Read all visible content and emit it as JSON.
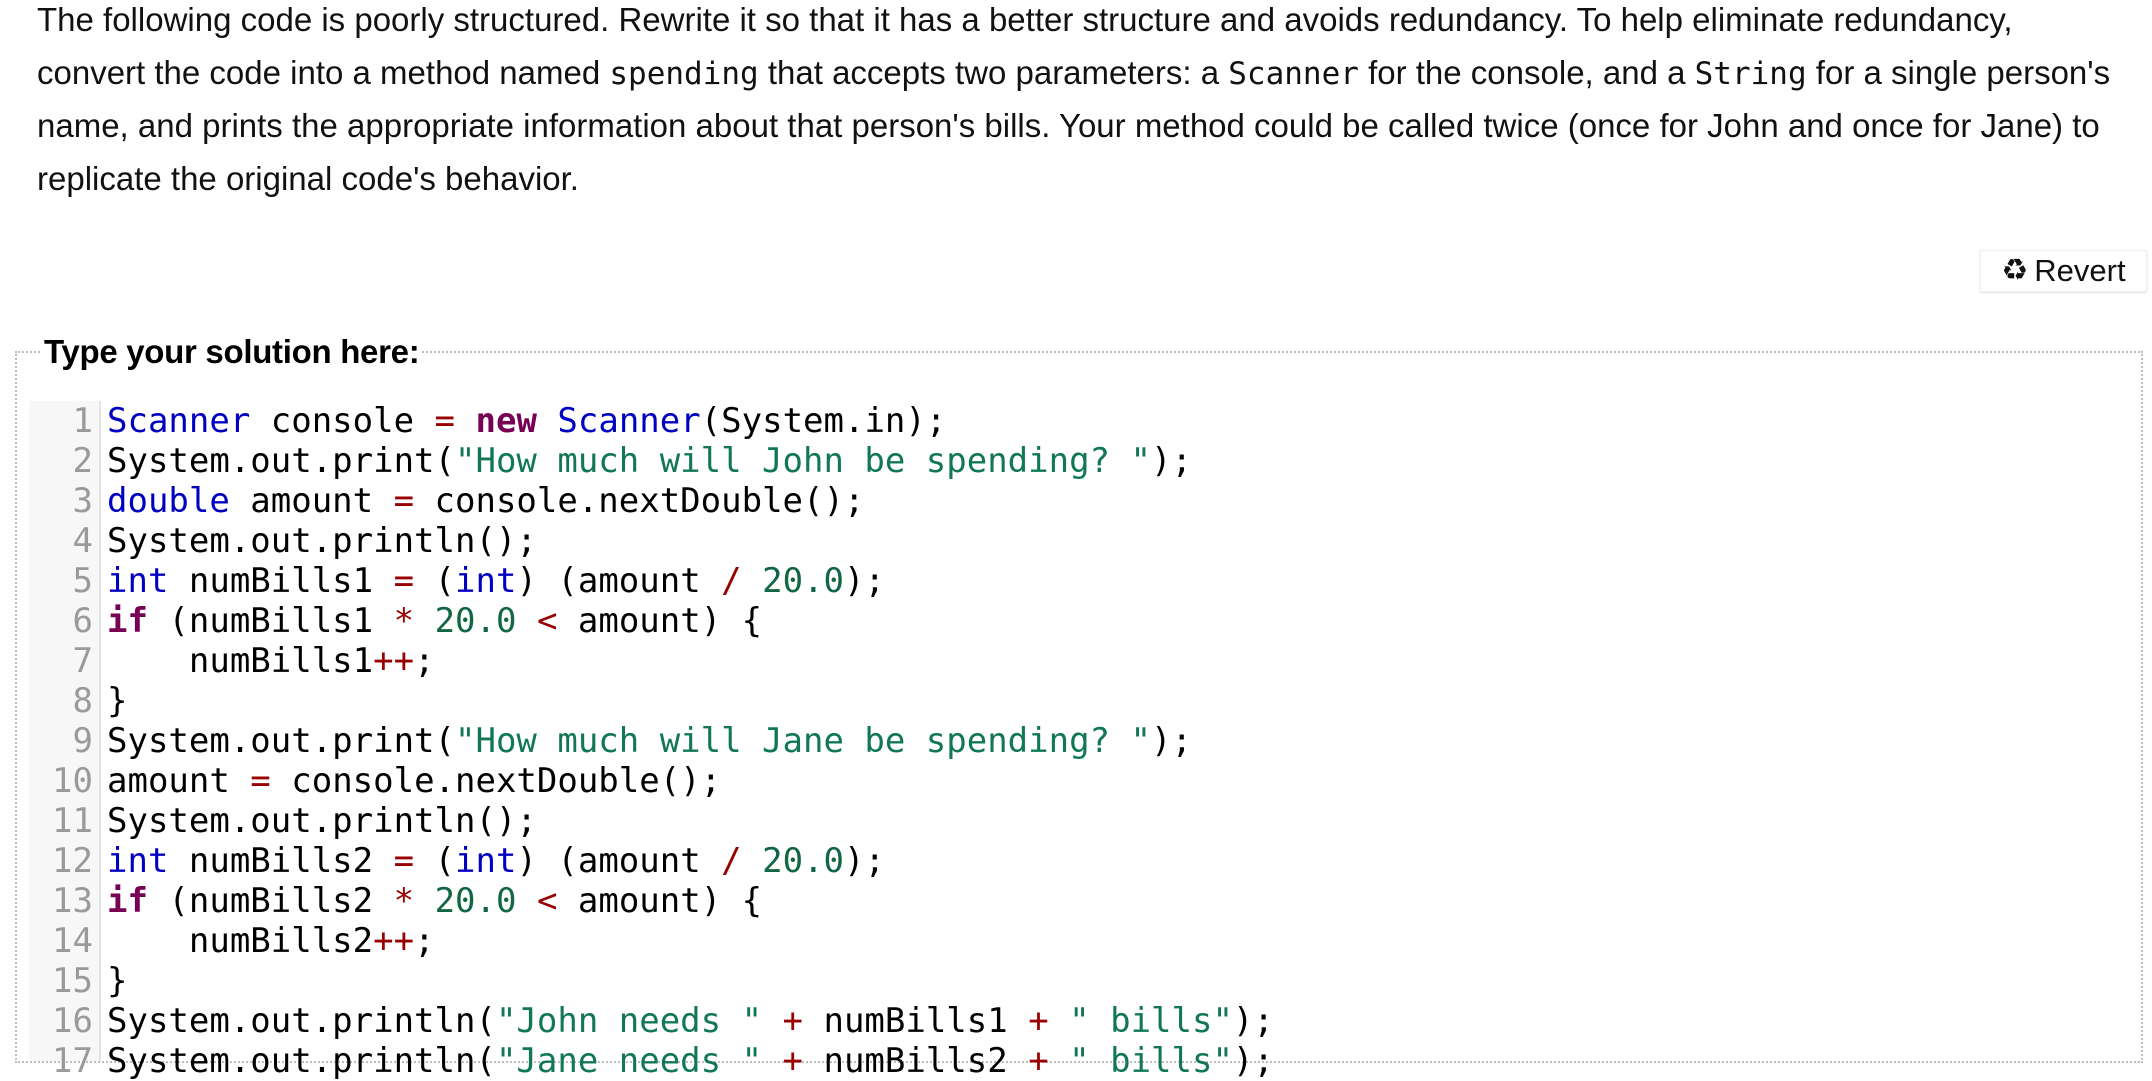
{
  "prompt": {
    "segments": [
      {
        "text": "The following code is poorly structured. Rewrite it so that it has a better structure and avoids redundancy. To help eliminate redundancy, convert the code into a method named ",
        "code": false
      },
      {
        "text": "spending",
        "code": true
      },
      {
        "text": " that accepts two parameters: a ",
        "code": false
      },
      {
        "text": "Scanner",
        "code": true
      },
      {
        "text": " for the console, and a ",
        "code": false
      },
      {
        "text": "String",
        "code": true
      },
      {
        "text": " for a single person's name, and prints the appropriate information about that person's bills. Your method could be called twice (once for John and once for Jane) to replicate the original code's behavior.",
        "code": false
      }
    ]
  },
  "revert_button": {
    "icon": "recycle-icon",
    "icon_glyph": "♻",
    "label": "Revert"
  },
  "editor": {
    "legend": "Type your solution here:",
    "colors": {
      "type": "#0000c0",
      "keyword": "#770055",
      "string": "#117755",
      "number": "#116644",
      "operator": "#990000"
    },
    "lines": [
      {
        "n": "1",
        "tokens": [
          [
            "type",
            "Scanner"
          ],
          [
            "plain",
            " console "
          ],
          [
            "op",
            "="
          ],
          [
            "plain",
            " "
          ],
          [
            "kw",
            "new"
          ],
          [
            "plain",
            " "
          ],
          [
            "type",
            "Scanner"
          ],
          [
            "plain",
            "(System.in);"
          ]
        ]
      },
      {
        "n": "2",
        "tokens": [
          [
            "plain",
            "System.out.print("
          ],
          [
            "str",
            "\"How much will John be spending? \""
          ],
          [
            "plain",
            ");"
          ]
        ]
      },
      {
        "n": "3",
        "tokens": [
          [
            "type",
            "double"
          ],
          [
            "plain",
            " amount "
          ],
          [
            "op",
            "="
          ],
          [
            "plain",
            " console.nextDouble();"
          ]
        ]
      },
      {
        "n": "4",
        "tokens": [
          [
            "plain",
            "System.out.println();"
          ]
        ]
      },
      {
        "n": "5",
        "tokens": [
          [
            "type",
            "int"
          ],
          [
            "plain",
            " numBills1 "
          ],
          [
            "op",
            "="
          ],
          [
            "plain",
            " ("
          ],
          [
            "type",
            "int"
          ],
          [
            "plain",
            ") (amount "
          ],
          [
            "op",
            "/"
          ],
          [
            "plain",
            " "
          ],
          [
            "num",
            "20.0"
          ],
          [
            "plain",
            ");"
          ]
        ]
      },
      {
        "n": "6",
        "tokens": [
          [
            "kw",
            "if"
          ],
          [
            "plain",
            " (numBills1 "
          ],
          [
            "op",
            "*"
          ],
          [
            "plain",
            " "
          ],
          [
            "num",
            "20.0"
          ],
          [
            "plain",
            " "
          ],
          [
            "op",
            "<"
          ],
          [
            "plain",
            " amount) {"
          ]
        ]
      },
      {
        "n": "7",
        "tokens": [
          [
            "plain",
            "    numBills1"
          ],
          [
            "op",
            "++"
          ],
          [
            "plain",
            ";"
          ]
        ]
      },
      {
        "n": "8",
        "tokens": [
          [
            "plain",
            "}"
          ]
        ]
      },
      {
        "n": "9",
        "tokens": [
          [
            "plain",
            "System.out.print("
          ],
          [
            "str",
            "\"How much will Jane be spending? \""
          ],
          [
            "plain",
            ");"
          ]
        ]
      },
      {
        "n": "10",
        "tokens": [
          [
            "plain",
            "amount "
          ],
          [
            "op",
            "="
          ],
          [
            "plain",
            " console.nextDouble();"
          ]
        ]
      },
      {
        "n": "11",
        "tokens": [
          [
            "plain",
            "System.out.println();"
          ]
        ]
      },
      {
        "n": "12",
        "tokens": [
          [
            "type",
            "int"
          ],
          [
            "plain",
            " numBills2 "
          ],
          [
            "op",
            "="
          ],
          [
            "plain",
            " ("
          ],
          [
            "type",
            "int"
          ],
          [
            "plain",
            ") (amount "
          ],
          [
            "op",
            "/"
          ],
          [
            "plain",
            " "
          ],
          [
            "num",
            "20.0"
          ],
          [
            "plain",
            ");"
          ]
        ]
      },
      {
        "n": "13",
        "tokens": [
          [
            "kw",
            "if"
          ],
          [
            "plain",
            " (numBills2 "
          ],
          [
            "op",
            "*"
          ],
          [
            "plain",
            " "
          ],
          [
            "num",
            "20.0"
          ],
          [
            "plain",
            " "
          ],
          [
            "op",
            "<"
          ],
          [
            "plain",
            " amount) {"
          ]
        ]
      },
      {
        "n": "14",
        "tokens": [
          [
            "plain",
            "    numBills2"
          ],
          [
            "op",
            "++"
          ],
          [
            "plain",
            ";"
          ]
        ]
      },
      {
        "n": "15",
        "tokens": [
          [
            "plain",
            "}"
          ]
        ]
      },
      {
        "n": "16",
        "tokens": [
          [
            "plain",
            "System.out.println("
          ],
          [
            "str",
            "\"John needs \""
          ],
          [
            "plain",
            " "
          ],
          [
            "op",
            "+"
          ],
          [
            "plain",
            " numBills1 "
          ],
          [
            "op",
            "+"
          ],
          [
            "plain",
            " "
          ],
          [
            "str",
            "\" bills\""
          ],
          [
            "plain",
            ");"
          ]
        ]
      },
      {
        "n": "17",
        "tokens": [
          [
            "plain",
            "System.out.println("
          ],
          [
            "str",
            "\"Jane needs \""
          ],
          [
            "plain",
            " "
          ],
          [
            "op",
            "+"
          ],
          [
            "plain",
            " numBills2 "
          ],
          [
            "op",
            "+"
          ],
          [
            "plain",
            " "
          ],
          [
            "str",
            "\" bills\""
          ],
          [
            "plain",
            ");"
          ]
        ]
      }
    ]
  }
}
